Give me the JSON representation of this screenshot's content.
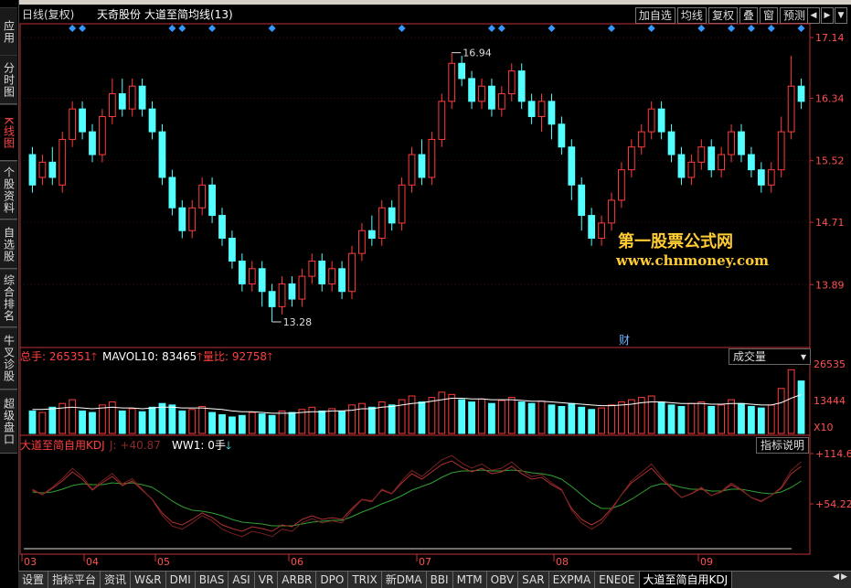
{
  "sidebar": [
    {
      "label": "应用",
      "active": false
    },
    {
      "label": "分时图",
      "active": false
    },
    {
      "label": "K线图",
      "active": true
    },
    {
      "label": "个股资料",
      "active": false
    },
    {
      "label": "自选股",
      "active": false
    },
    {
      "label": "综合排名",
      "active": false
    },
    {
      "label": "牛叉诊股",
      "active": false
    },
    {
      "label": "超级盘口",
      "active": false
    }
  ],
  "header": {
    "period": "日线(复权)",
    "stock": "天奇股份",
    "formula": "大道至简均线(13)",
    "buttons": [
      "加自选",
      "均线",
      "复权",
      "叠",
      "窗",
      "预测"
    ]
  },
  "price_axis": [
    "17.14",
    "16.34",
    "15.52",
    "14.71",
    "13.89"
  ],
  "price_markers": {
    "high": "16.94",
    "low": "13.28"
  },
  "watermark": {
    "line1": "第一股票公式网",
    "line2": "www.chnmoney.com"
  },
  "cai_label": "财",
  "volume_panel": {
    "total_label": "总手:",
    "total_value": "265351",
    "mavol_label": "MAVOL10:",
    "mavol_value": "83465",
    "ratio_label": "量比:",
    "ratio_value": "92758",
    "dropdown": "成交量",
    "axis": [
      "26535",
      "13444",
      "X10"
    ]
  },
  "kdj_panel": {
    "name": "大道至简自用KDJ",
    "j_label": "J:",
    "j_value": "+40.87",
    "ww_label": "WW1:",
    "ww_value": "0手",
    "help": "指标说明",
    "axis": [
      "+114.6",
      "+54.22"
    ]
  },
  "months": [
    "03",
    "04",
    "05",
    "06",
    "07",
    "08",
    "09"
  ],
  "tabs": [
    "设置",
    "指标平台",
    "资讯",
    "W&R",
    "DMI",
    "BIAS",
    "ASI",
    "VR",
    "ARBR",
    "DPO",
    "TRIX",
    "新DMA",
    "BBI",
    "MTM",
    "OBV",
    "SAR",
    "EXPMA",
    "ENE0E",
    "大道至简自用KDJ"
  ],
  "active_tab": "大道至简自用KDJ",
  "colors": {
    "up": "#ff3c3c",
    "down": "#54ffff",
    "ma": "#ffffff",
    "axis": "#c03030",
    "k": "#b03030",
    "d": "#30a030",
    "diamond": "#3399ff"
  },
  "chart_data": {
    "type": "candlestick",
    "ylim": [
      13.4,
      17.2
    ],
    "candles": [
      [
        15.6,
        15.2,
        15.7,
        15.1
      ],
      [
        15.3,
        15.5,
        15.6,
        15.2
      ],
      [
        15.5,
        15.3,
        15.7,
        15.2
      ],
      [
        15.2,
        15.8,
        15.9,
        15.1
      ],
      [
        15.8,
        16.2,
        16.3,
        15.7
      ],
      [
        16.2,
        15.9,
        16.3,
        15.8
      ],
      [
        15.9,
        15.6,
        16.0,
        15.5
      ],
      [
        15.6,
        16.1,
        16.2,
        15.5
      ],
      [
        16.1,
        16.4,
        16.6,
        16.0
      ],
      [
        16.4,
        16.2,
        16.6,
        16.1
      ],
      [
        16.2,
        16.5,
        16.6,
        16.1
      ],
      [
        16.5,
        16.2,
        16.6,
        16.1
      ],
      [
        16.2,
        15.9,
        16.3,
        15.8
      ],
      [
        15.9,
        15.3,
        16.0,
        15.2
      ],
      [
        15.3,
        14.9,
        15.4,
        14.8
      ],
      [
        14.9,
        14.6,
        15.0,
        14.5
      ],
      [
        14.6,
        14.9,
        15.0,
        14.5
      ],
      [
        14.9,
        15.2,
        15.3,
        14.8
      ],
      [
        15.2,
        14.8,
        15.3,
        14.7
      ],
      [
        14.8,
        14.5,
        14.9,
        14.4
      ],
      [
        14.5,
        14.2,
        14.6,
        14.1
      ],
      [
        14.2,
        13.9,
        14.3,
        13.8
      ],
      [
        13.9,
        14.1,
        14.2,
        13.8
      ],
      [
        14.1,
        13.8,
        14.2,
        13.6
      ],
      [
        13.8,
        13.6,
        13.9,
        13.4
      ],
      [
        13.6,
        13.9,
        14.0,
        13.5
      ],
      [
        13.9,
        13.7,
        14.0,
        13.6
      ],
      [
        13.7,
        14.0,
        14.1,
        13.6
      ],
      [
        14.0,
        14.2,
        14.3,
        13.9
      ],
      [
        14.2,
        13.9,
        14.3,
        13.8
      ],
      [
        13.9,
        14.1,
        14.2,
        13.8
      ],
      [
        14.1,
        13.8,
        14.2,
        13.7
      ],
      [
        13.8,
        14.3,
        14.4,
        13.7
      ],
      [
        14.3,
        14.6,
        14.7,
        14.2
      ],
      [
        14.6,
        14.5,
        14.8,
        14.4
      ],
      [
        14.5,
        14.9,
        15.0,
        14.4
      ],
      [
        14.9,
        14.7,
        15.0,
        14.6
      ],
      [
        14.7,
        15.2,
        15.3,
        14.6
      ],
      [
        15.2,
        15.6,
        15.7,
        15.1
      ],
      [
        15.6,
        15.3,
        15.8,
        15.2
      ],
      [
        15.3,
        15.8,
        15.9,
        15.2
      ],
      [
        15.8,
        16.3,
        16.4,
        15.7
      ],
      [
        16.3,
        16.8,
        16.94,
        16.2
      ],
      [
        16.8,
        16.6,
        16.9,
        16.5
      ],
      [
        16.6,
        16.3,
        16.7,
        16.2
      ],
      [
        16.3,
        16.5,
        16.6,
        16.2
      ],
      [
        16.5,
        16.2,
        16.6,
        16.1
      ],
      [
        16.2,
        16.4,
        16.5,
        16.1
      ],
      [
        16.4,
        16.7,
        16.8,
        16.3
      ],
      [
        16.7,
        16.3,
        16.8,
        16.2
      ],
      [
        16.3,
        16.1,
        16.4,
        16.0
      ],
      [
        16.1,
        16.3,
        16.4,
        15.9
      ],
      [
        16.3,
        16.0,
        16.4,
        15.8
      ],
      [
        16.0,
        15.7,
        16.1,
        15.6
      ],
      [
        15.7,
        15.2,
        15.8,
        15.0
      ],
      [
        15.2,
        14.8,
        15.3,
        14.6
      ],
      [
        14.8,
        14.5,
        14.9,
        14.4
      ],
      [
        14.5,
        14.7,
        14.8,
        14.4
      ],
      [
        14.7,
        15.0,
        15.1,
        14.6
      ],
      [
        15.0,
        15.4,
        15.5,
        14.9
      ],
      [
        15.4,
        15.7,
        15.8,
        15.3
      ],
      [
        15.7,
        15.9,
        16.0,
        15.6
      ],
      [
        15.9,
        16.2,
        16.3,
        15.8
      ],
      [
        16.2,
        15.9,
        16.3,
        15.8
      ],
      [
        15.9,
        15.6,
        16.0,
        15.5
      ],
      [
        15.6,
        15.3,
        15.7,
        15.2
      ],
      [
        15.3,
        15.5,
        15.6,
        15.2
      ],
      [
        15.5,
        15.7,
        15.8,
        15.4
      ],
      [
        15.7,
        15.4,
        15.8,
        15.3
      ],
      [
        15.4,
        15.6,
        15.7,
        15.3
      ],
      [
        15.6,
        15.9,
        16.0,
        15.5
      ],
      [
        15.9,
        15.6,
        16.0,
        15.5
      ],
      [
        15.6,
        15.4,
        15.7,
        15.3
      ],
      [
        15.4,
        15.2,
        15.5,
        15.1
      ],
      [
        15.2,
        15.4,
        15.5,
        15.1
      ],
      [
        15.4,
        15.9,
        16.1,
        15.3
      ],
      [
        15.9,
        16.5,
        16.9,
        15.8
      ],
      [
        16.5,
        16.3,
        16.6,
        16.2
      ]
    ],
    "volume": [
      30,
      28,
      35,
      40,
      45,
      30,
      28,
      38,
      42,
      30,
      33,
      29,
      35,
      40,
      38,
      30,
      32,
      36,
      28,
      25,
      22,
      24,
      28,
      26,
      24,
      30,
      28,
      32,
      35,
      30,
      33,
      30,
      38,
      40,
      35,
      42,
      38,
      45,
      50,
      42,
      48,
      55,
      52,
      45,
      42,
      46,
      40,
      44,
      48,
      42,
      40,
      43,
      38,
      36,
      40,
      35,
      32,
      34,
      38,
      42,
      45,
      48,
      50,
      42,
      38,
      36,
      40,
      42,
      36,
      38,
      45,
      40,
      36,
      34,
      38,
      60,
      85,
      70
    ],
    "volume_ma": [
      32,
      32,
      33,
      34,
      35,
      34,
      33,
      34,
      35,
      34,
      34,
      33,
      34,
      35,
      35,
      34,
      34,
      34,
      33,
      32,
      30,
      29,
      29,
      28,
      27,
      27,
      27,
      28,
      29,
      29,
      30,
      30,
      31,
      33,
      33,
      35,
      36,
      38,
      40,
      41,
      43,
      45,
      47,
      47,
      46,
      46,
      45,
      45,
      45,
      44,
      43,
      43,
      42,
      41,
      40,
      39,
      38,
      37,
      37,
      38,
      39,
      41,
      42,
      42,
      41,
      40,
      40,
      40,
      39,
      39,
      40,
      40,
      39,
      38,
      38,
      41,
      47,
      52
    ],
    "k": [
      60,
      55,
      62,
      70,
      80,
      72,
      60,
      68,
      75,
      65,
      70,
      60,
      50,
      35,
      25,
      22,
      28,
      35,
      30,
      22,
      18,
      15,
      20,
      18,
      15,
      22,
      20,
      28,
      32,
      28,
      30,
      28,
      40,
      50,
      48,
      60,
      56,
      68,
      78,
      72,
      80,
      88,
      92,
      85,
      80,
      84,
      78,
      80,
      86,
      78,
      72,
      74,
      66,
      60,
      40,
      28,
      22,
      28,
      40,
      55,
      68,
      76,
      84,
      72,
      62,
      52,
      56,
      62,
      54,
      58,
      66,
      60,
      52,
      48,
      54,
      62,
      78,
      86
    ],
    "d": [
      58,
      57,
      58,
      61,
      65,
      67,
      66,
      66,
      68,
      67,
      68,
      66,
      63,
      56,
      48,
      42,
      38,
      37,
      35,
      32,
      28,
      25,
      24,
      23,
      21,
      21,
      21,
      23,
      25,
      26,
      27,
      27,
      31,
      36,
      40,
      45,
      49,
      54,
      60,
      64,
      68,
      74,
      79,
      81,
      81,
      82,
      81,
      81,
      82,
      81,
      79,
      78,
      76,
      72,
      64,
      55,
      46,
      40,
      40,
      44,
      50,
      57,
      64,
      67,
      66,
      63,
      61,
      61,
      59,
      59,
      61,
      61,
      59,
      57,
      56,
      58,
      63,
      70
    ]
  }
}
